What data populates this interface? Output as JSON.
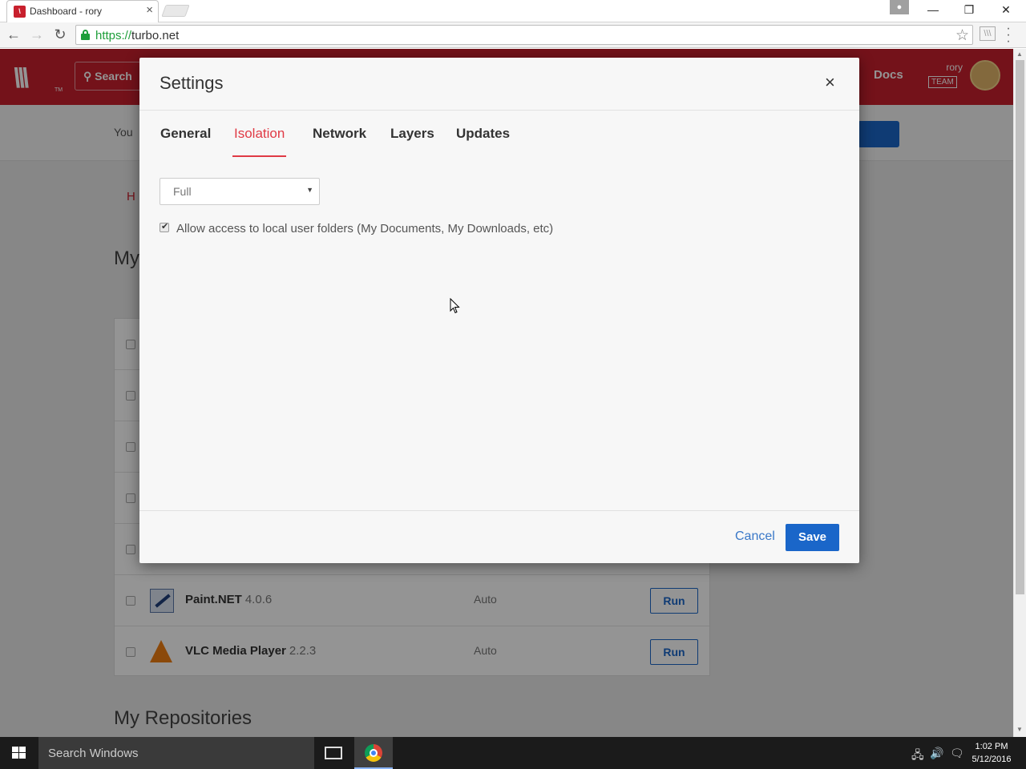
{
  "browser": {
    "tab_title": "Dashboard - rory",
    "tab_close": "×",
    "url_scheme": "https://",
    "url_host": "turbo.net",
    "window_min": "—",
    "window_restore": "❐",
    "window_close": "✕"
  },
  "site": {
    "search_label": "Search",
    "docs_label": "Docs",
    "user_name": "rory",
    "user_team": "TEAM",
    "notice_text": "You",
    "breadcrumb": "H",
    "my_apps_title": "My",
    "my_repos_title": "My Repositories",
    "apps": [
      {
        "name": "Paint.NET",
        "version": "4.0.6",
        "mode": "Auto",
        "run_label": "Run"
      },
      {
        "name": "VLC Media Player",
        "version": "2.2.3",
        "mode": "Auto",
        "run_label": "Run"
      }
    ]
  },
  "modal": {
    "title": "Settings",
    "close": "×",
    "tabs": [
      {
        "label": "General"
      },
      {
        "label": "Isolation"
      },
      {
        "label": "Network"
      },
      {
        "label": "Layers"
      },
      {
        "label": "Updates"
      }
    ],
    "active_tab": "Isolation",
    "isolation_select_value": "Full",
    "allow_local_folders_label": "Allow access to local user folders (My Documents, My Downloads, etc)",
    "allow_local_folders_checked": true,
    "cancel_label": "Cancel",
    "save_label": "Save"
  },
  "taskbar": {
    "search_placeholder": "Search Windows",
    "time": "1:02 PM",
    "date": "5/12/2016"
  },
  "colors": {
    "brand_red": "#c8202d",
    "active_tab": "#e03a45",
    "primary_blue": "#1a66c9"
  }
}
